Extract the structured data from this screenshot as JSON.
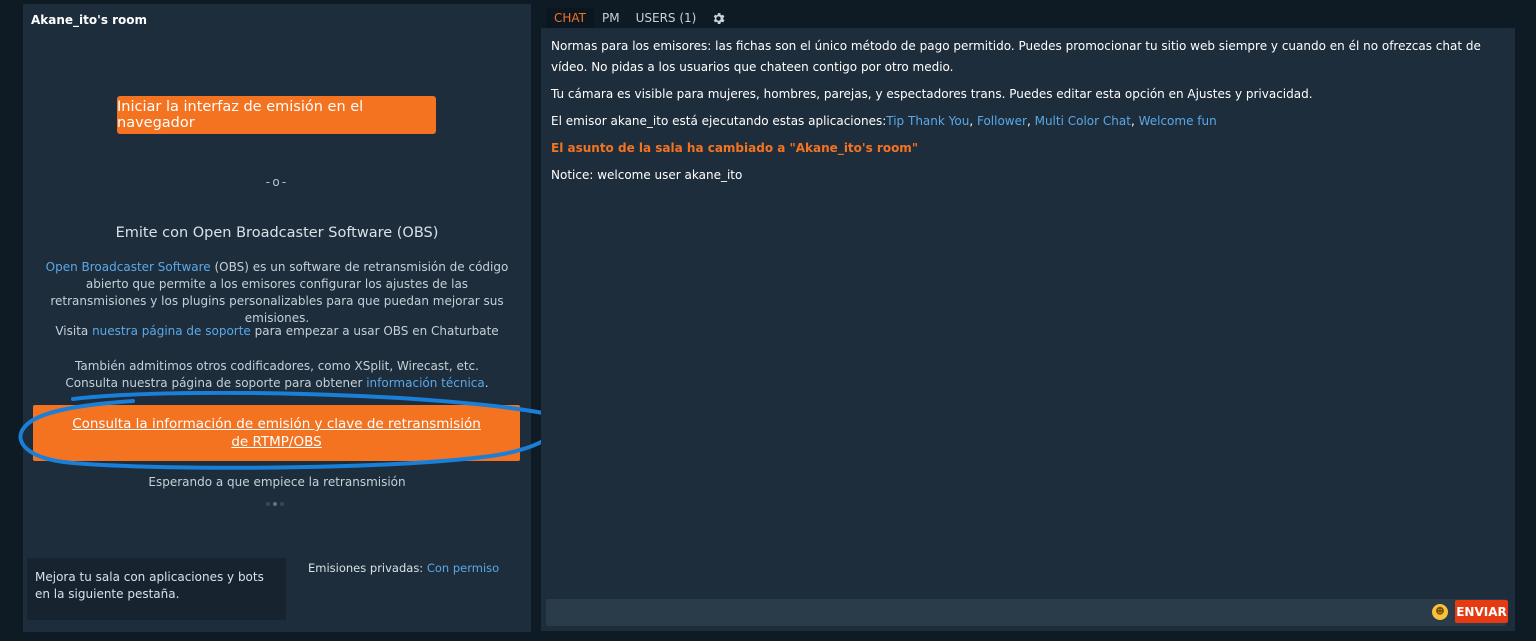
{
  "room": {
    "title": "Akane_ito's room"
  },
  "broadcast": {
    "browser_button": "Iniciar la interfaz de emisión en el navegador",
    "separator": "-o-",
    "obs_heading": "Emite con Open Broadcaster Software (OBS)",
    "obs_link": "Open Broadcaster Software",
    "obs_desc": " (OBS) es un software de retransmisión de código abierto que permite a los emisores configurar los ajustes de las retransmisiones y los plugins personalizables para que puedan mejorar sus emisiones.",
    "visit_prefix": "Visita ",
    "visit_link": "nuestra página de soporte",
    "visit_suffix": " para empezar a usar OBS en Chaturbate",
    "other_line1": "También admitimos otros codificadores, como XSplit, Wirecast, etc.",
    "other_line2_prefix": "Consulta nuestra página de soporte para obtener ",
    "other_line2_link": "información técnica",
    "other_line2_suffix": ".",
    "rtmp_button": "Consulta la información de emisión y clave de retransmisión de RTMP/OBS",
    "waiting": "Esperando a que empiece la retransmisión"
  },
  "apps_box": {
    "text": "Mejora tu sala con aplicaciones y bots en la siguiente pestaña."
  },
  "private_shows": {
    "label": "Emisiones privadas: ",
    "value": "Con permiso"
  },
  "tabs": [
    {
      "label": "CHAT",
      "active": true
    },
    {
      "label": "PM",
      "active": false
    },
    {
      "label": "USERS (1)",
      "active": false
    }
  ],
  "chat": {
    "rules": "Normas para los emisores: las fichas son el único método de pago permitido. Puedes promocionar tu sitio web siempre y cuando en él no ofrezcas chat de vídeo. No pidas a los usuarios que chateen contigo por otro medio.",
    "visibility": "Tu cámara es visible para mujeres, hombres, parejas, y espectadores trans. Puedes editar esta opción en Ajustes y privacidad.",
    "apps_prefix": "El emisor akane_ito está ejecutando estas aplicaciones:",
    "apps": [
      "Tip Thank You",
      "Follower",
      "Multi Color Chat",
      "Welcome fun"
    ],
    "subject": "El asunto de la sala ha cambiado a \"Akane_ito's room\"",
    "notice": "Notice: welcome user akane_ito",
    "send_label": "ENVIAR"
  },
  "colors": {
    "accent": "#f47321",
    "link": "#5aa8e8",
    "send": "#e63b12",
    "annotation": "#1a7fd8"
  },
  "icons": {
    "settings": "gear-icon",
    "emoji": "emoji-icon"
  }
}
